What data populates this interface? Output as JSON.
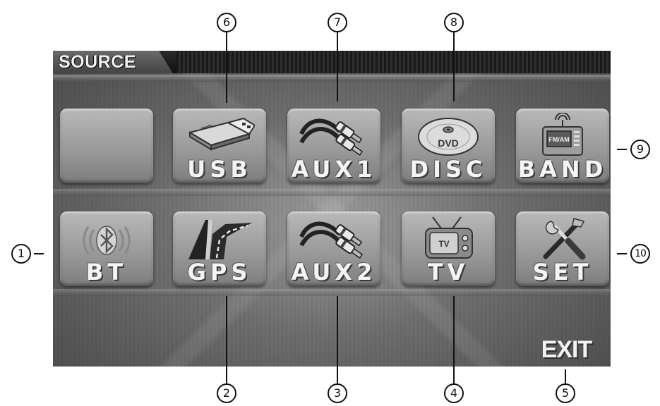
{
  "screen": {
    "title": "SOURCE",
    "exit_label": "EXIT"
  },
  "tiles": [
    {
      "label": "",
      "icon": "blank-tile"
    },
    {
      "label": "USB",
      "icon": "usb-drive-icon"
    },
    {
      "label": "AUX1",
      "icon": "rca-cable-icon"
    },
    {
      "label": "DISC",
      "icon": "dvd-disc-icon"
    },
    {
      "label": "BAND",
      "icon": "fm-am-radio-icon"
    },
    {
      "label": "BT",
      "icon": "bluetooth-icon"
    },
    {
      "label": "GPS",
      "icon": "road-icon"
    },
    {
      "label": "AUX2",
      "icon": "rca-cable-icon"
    },
    {
      "label": "TV",
      "icon": "tv-icon"
    },
    {
      "label": "SET",
      "icon": "tools-icon"
    }
  ],
  "callouts": [
    "1",
    "2",
    "3",
    "4",
    "5",
    "6",
    "7",
    "8",
    "9",
    "10"
  ],
  "colors": {
    "screen_dark": "#4a4a4a",
    "tile_face": "#9a9a9a",
    "label_text": "#f4f4f4"
  }
}
